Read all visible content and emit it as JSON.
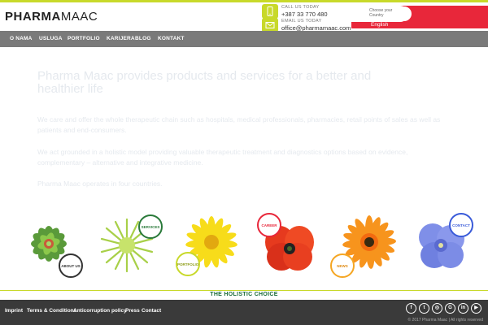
{
  "logo": {
    "bold": "PHARMA",
    "light": "MAAC"
  },
  "contact": {
    "phone_label": "CALL US TODAY",
    "phone": "+387 33 770 480",
    "email_label": "EMAIL US TODAY",
    "email": "office@pharmamaac.com"
  },
  "country": {
    "placeholder": "Choose your Country",
    "language": "English"
  },
  "nav": [
    "O NAMA",
    "USLUGA",
    "PORTFOLIO",
    "KARIJERA",
    "BLOG",
    "KONTAKT"
  ],
  "hero": {
    "title": "Pharma Maac provides products and services for a better and healthier life",
    "paragraphs": [
      "We care and offer the whole therapeutic chain such as hospitals, medical professionals, pharmacies, retail points of sales as well as patients and end-consumers.",
      "We act grounded in a holistic model providing valuable therapeutic treatment and diagnostics options based on evidence, complementary – alternative and integrative medicine.",
      "Pharma Maac operates in four countries."
    ]
  },
  "flowers": [
    {
      "badge": "ABOUT US",
      "badge_color": "#2a7a3a"
    },
    {
      "badge": "SERVICES",
      "badge_color": "#2a7a3a"
    },
    {
      "badge": "PORTFOLIO",
      "badge_color": "#c8d92a"
    },
    {
      "badge": "CAREER",
      "badge_color": "#e8273a"
    },
    {
      "badge": "NEWS",
      "badge_color": "#f5a623"
    },
    {
      "badge": "CONTACT",
      "badge_color": "#3a5bd9"
    }
  ],
  "tagline": "THE HOLISTIC CHOICE",
  "footer": {
    "links": [
      "Imprint",
      "Terms & Conditions",
      "Anticorruption policy",
      "Press",
      "Contact"
    ],
    "social": [
      "facebook-icon",
      "twitter-icon",
      "instagram-icon",
      "google-icon",
      "linkedin-icon",
      "youtube-icon"
    ],
    "copyright": "© 2017 Pharma Maac | All rights reserved"
  },
  "colors": {
    "accent": "#c8d92a",
    "nav": "#7a7a7a",
    "country": "#e8273a",
    "footer": "#3a3a3a",
    "tagline": "#1a6b3a"
  }
}
